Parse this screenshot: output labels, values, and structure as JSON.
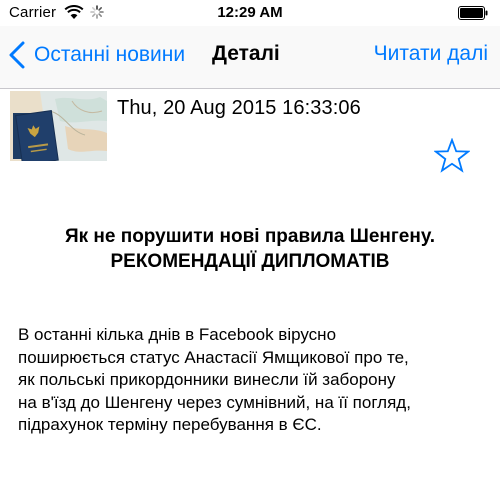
{
  "status_bar": {
    "carrier": "Carrier",
    "time": "12:29 AM"
  },
  "nav": {
    "back_label": "Останні новини",
    "title": "Деталі",
    "action_label": "Читати далі"
  },
  "article": {
    "date": "Thu, 20 Aug 2015 16:33:06",
    "title_lines": [
      "Як не порушити нові правила Шенгену.",
      "РЕКОМЕНДАЦІЇ ДИПЛОМАТІВ"
    ],
    "body_lines": [
      "В останні кілька днів в Facebook вірусно",
      "поширюється статус Анастасії Ямщикової про те,",
      "як польські прикордонники винесли їй заборону",
      "на в'їзд до Шенгену через сумнівний, на її погляд,",
      "підрахунок терміну перебування в ЄС."
    ]
  },
  "icons": {
    "wifi": "wifi-icon",
    "spinner": "activity-spinner-icon",
    "battery": "battery-icon",
    "back": "chevron-left-icon",
    "favorite": "star-outline-icon",
    "thumbnail": "passport-image"
  },
  "colors": {
    "accent": "#007aff",
    "text": "#000000",
    "background": "#ffffff"
  }
}
